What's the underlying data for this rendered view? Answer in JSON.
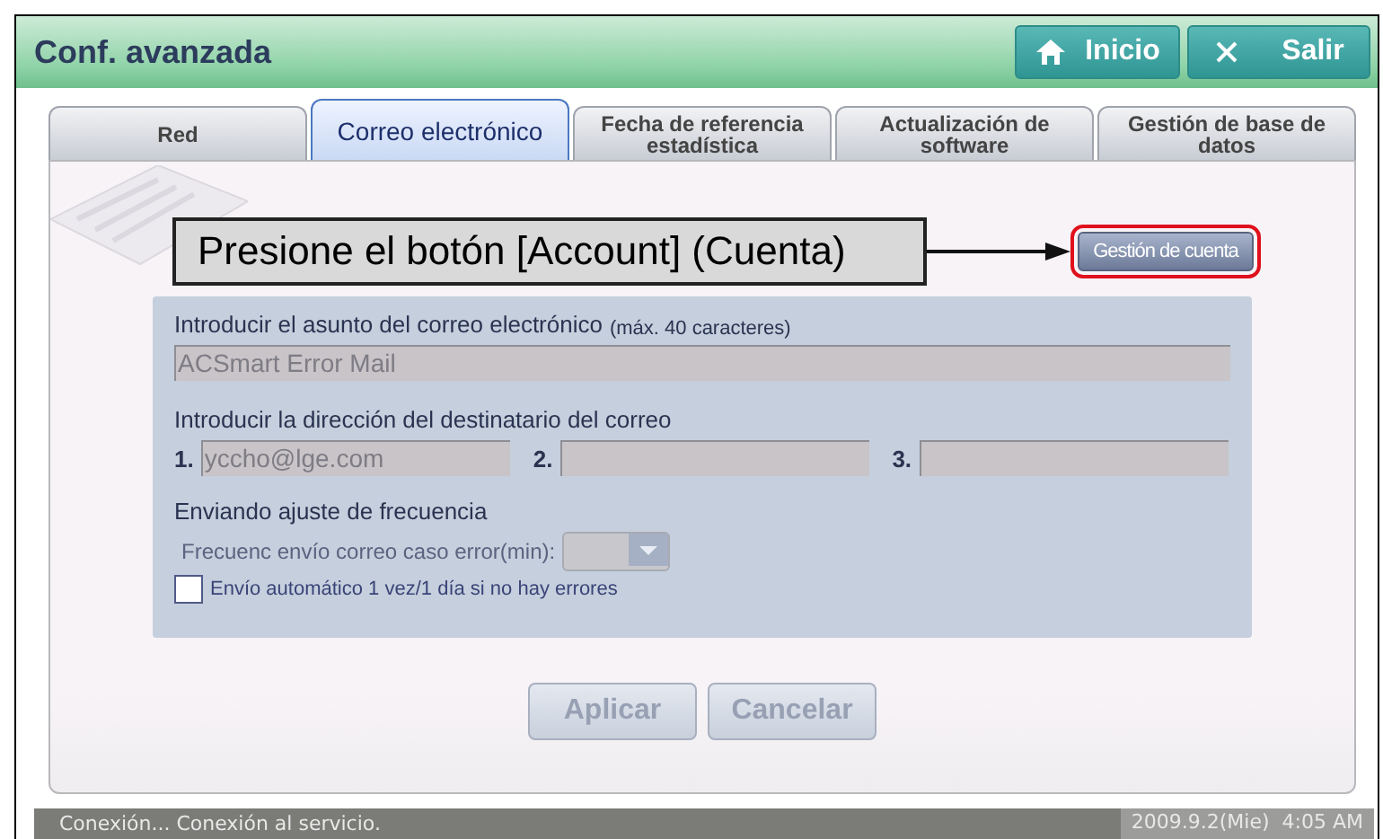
{
  "window": {
    "title": "Conf. avanzada"
  },
  "header_buttons": [
    {
      "kind": "home",
      "label": "Inicio"
    },
    {
      "kind": "close",
      "label": "Salir"
    }
  ],
  "tabs": [
    {
      "label": "Red",
      "selected": false
    },
    {
      "label": "Correo electrónico",
      "selected": true
    },
    {
      "label": "Fecha de referencia estadística",
      "selected": false
    },
    {
      "label": "Actualización de software",
      "selected": false
    },
    {
      "label": "Gestión de base de datos",
      "selected": false
    }
  ],
  "callout": {
    "text": "Presione el botón [Account] (Cuenta)"
  },
  "account_button": {
    "label": "Gestión de cuenta",
    "highlighted": true
  },
  "subject": {
    "label": "Introducir el asunto del correo electrónico",
    "hint": "(máx. 40 caracteres)",
    "value": "ACSmart Error Mail",
    "disabled": true
  },
  "recipients": {
    "label": "Introducir la dirección del destinatario del correo",
    "fields": [
      {
        "number": "1.",
        "value": "yccho@lge.com"
      },
      {
        "number": "2."
      },
      {
        "number": "3."
      }
    ]
  },
  "frequency": {
    "heading": "Enviando ajuste de frecuencia",
    "error_label": "Frecuenc envío correo caso error(min):",
    "daily": {
      "label": "Envío automático 1 vez/1 día si no hay errores",
      "checked": false
    }
  },
  "buttons": [
    {
      "label": "Aplicar",
      "disabled": true
    },
    {
      "label": "Cancelar",
      "disabled": true
    }
  ],
  "status_bar": {
    "message": "Conexión... Conexión al servicio.",
    "datetime": "2009.9.2(Mie)  4:05 AM"
  }
}
